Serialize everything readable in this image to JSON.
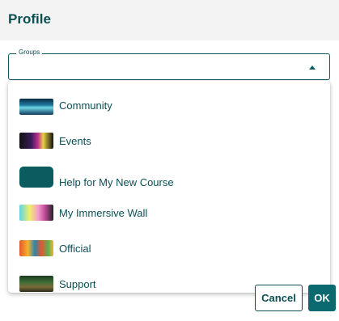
{
  "header": {
    "title": "Profile"
  },
  "groups_select": {
    "legend": "Groups",
    "value": "",
    "options": [
      {
        "label": "Community",
        "thumbnail": "community-thumbnail"
      },
      {
        "label": "Events",
        "thumbnail": "events-thumbnail"
      },
      {
        "label": "Help for My New Course",
        "thumbnail": "help-course-thumbnail"
      },
      {
        "label": "My Immersive Wall",
        "thumbnail": "immersive-wall-thumbnail"
      },
      {
        "label": "Official",
        "thumbnail": "official-thumbnail"
      },
      {
        "label": "Support",
        "thumbnail": "support-thumbnail"
      }
    ]
  },
  "footer": {
    "cancel_label": "Cancel",
    "ok_label": "OK"
  },
  "colors": {
    "primary": "#0b5c62",
    "text": "#0b4f54",
    "header_bg": "#f3f3f3"
  }
}
